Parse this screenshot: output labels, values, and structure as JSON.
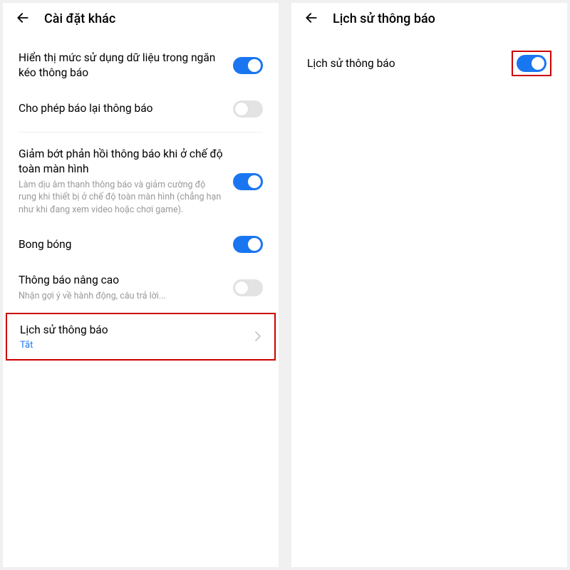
{
  "left": {
    "header_title": "Cài đặt khác",
    "items": {
      "data_usage": {
        "title": "Hiển thị mức sử dụng dữ liệu trong ngăn kéo thông báo",
        "on": true
      },
      "snooze": {
        "title": "Cho phép báo lại thông báo",
        "on": false
      },
      "fullscreen": {
        "title": "Giảm bớt phản hồi thông báo khi ở chế độ toàn màn hình",
        "sub": "Làm dịu âm thanh thông báo và giảm cường độ rung khi thiết bị ở chế độ toàn màn hình (chẳng hạn như khi đang xem video hoặc chơi game).",
        "on": true
      },
      "bubbles": {
        "title": "Bong bóng",
        "on": true
      },
      "enhanced": {
        "title": "Thông báo nâng cao",
        "sub": "Nhận gợi ý về hành động, câu trả lời...",
        "on": false
      },
      "history": {
        "title": "Lịch sử thông báo",
        "status": "Tắt"
      }
    }
  },
  "right": {
    "header_title": "Lịch sử thông báo",
    "toggle": {
      "title": "Lịch sử thông báo",
      "on": true
    }
  }
}
